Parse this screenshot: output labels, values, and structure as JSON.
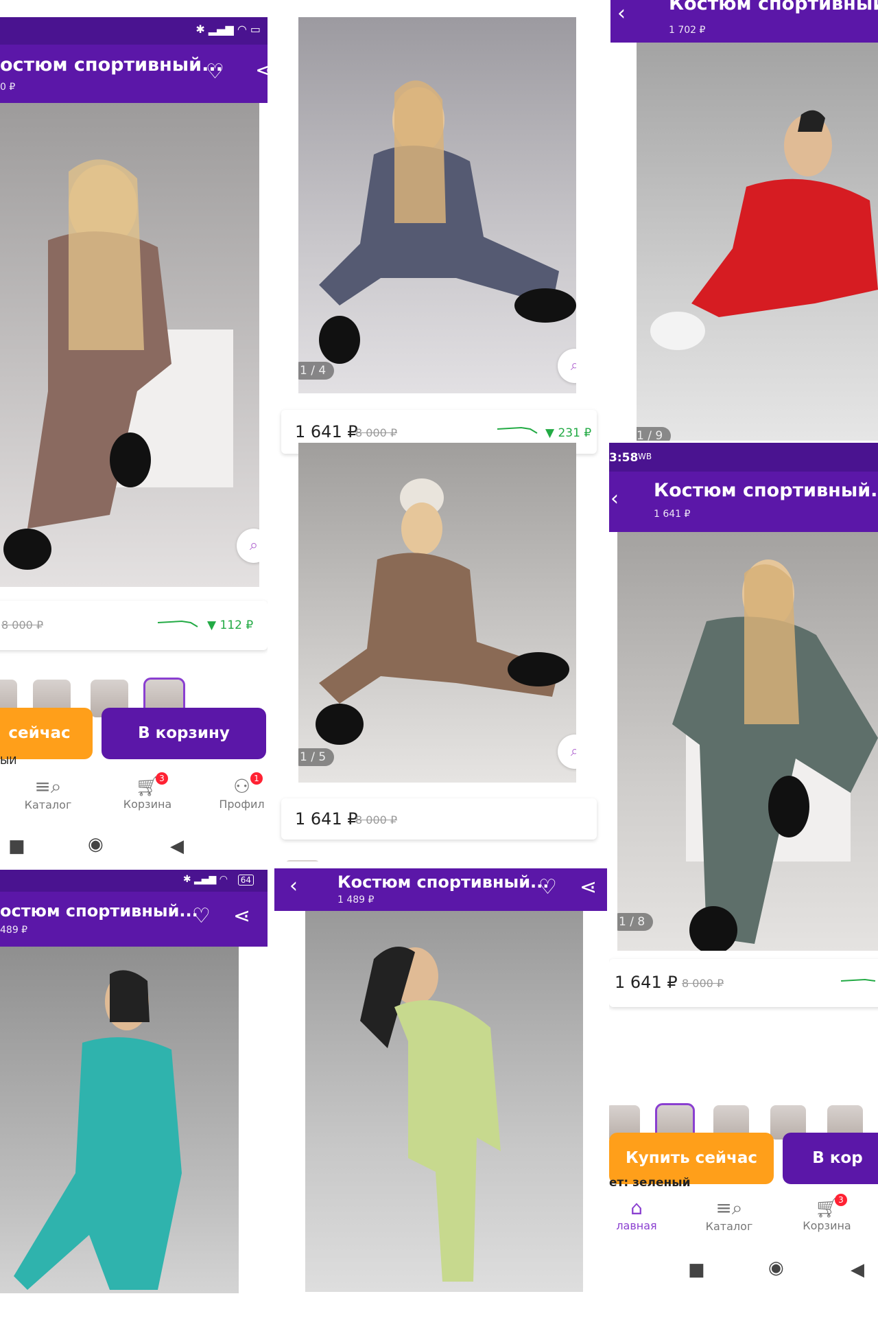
{
  "p1": {
    "title": "остюм спортивный...",
    "sub": "0 ₽",
    "old": "8 000 ₽",
    "delta": "▼ 112 ₽",
    "buy": "сейчас",
    "cart": "В корзину",
    "below": "ЫИ",
    "nav": {
      "catalog": "Каталог",
      "cart": "Корзина",
      "profile": "Профил",
      "cart_badge": "3",
      "profile_badge": "1"
    }
  },
  "p2": {
    "counter1": "1 / 4",
    "price1": "1 641 ₽",
    "old1": "8 000 ₽",
    "delta1": "▼ 231 ₽",
    "counter2": "1 / 5",
    "price2": "1 641 ₽",
    "old2": "8 000 ₽"
  },
  "p3": {
    "title": "Костюм спортивный...",
    "sub": "1 702 ₽",
    "counter": "1 / 9"
  },
  "p4": {
    "time": "3:58",
    "wb": "WB",
    "title": "Костюм спортивный...",
    "sub": "1 641 ₽",
    "counter": "1 / 8",
    "price": "1 641 ₽",
    "old": "8 000 ₽",
    "buy": "Купить сейчас",
    "cart": "В кор",
    "color": "ет: зеленый",
    "nav": {
      "home": "лавная",
      "catalog": "Каталог",
      "cart": "Корзина",
      "cart_badge": "3"
    }
  },
  "p5": {
    "title": "остюм спортивный...",
    "sub": "489 ₽",
    "battery": "64"
  },
  "p6": {
    "title": "Костюм спортивный...",
    "sub": "1 489 ₽"
  },
  "colors": {
    "purple": "#5b17a8",
    "orange": "#ff9f1a",
    "green": "#22aa44"
  }
}
